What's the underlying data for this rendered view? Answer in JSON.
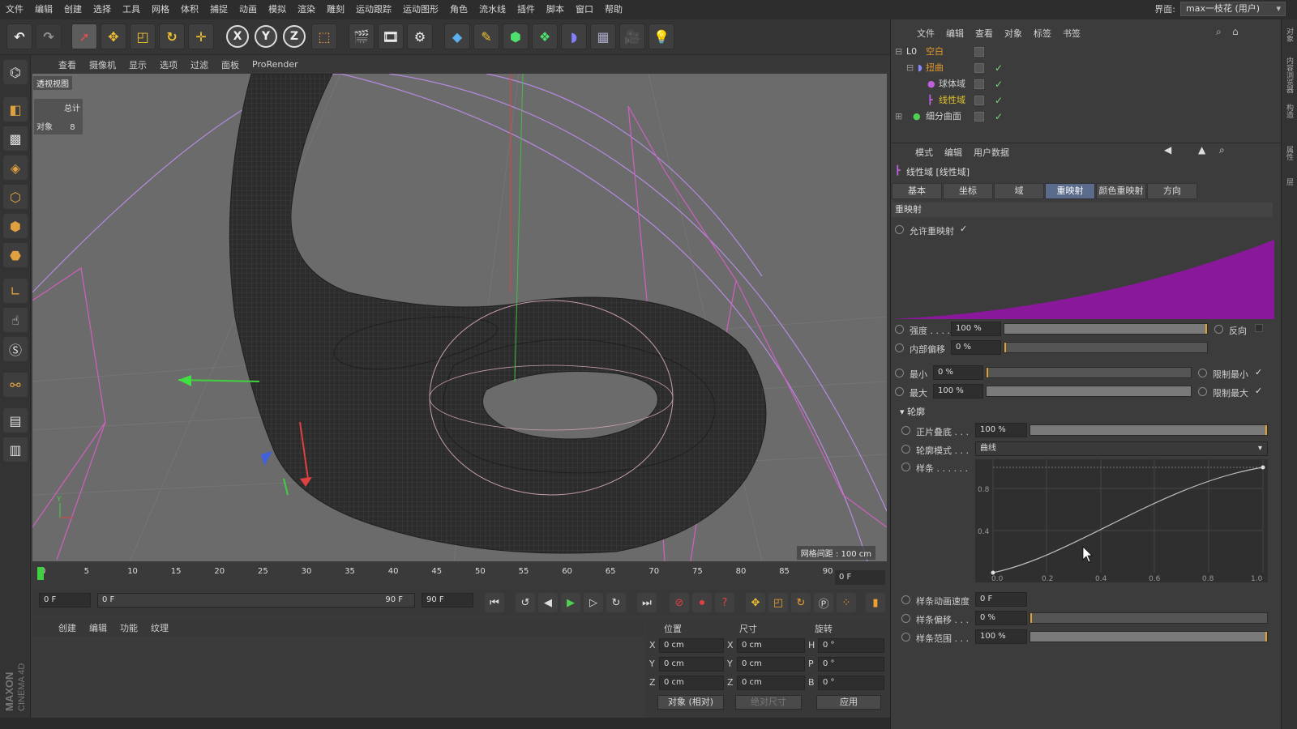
{
  "menubar": {
    "items": [
      "文件",
      "编辑",
      "创建",
      "选择",
      "工具",
      "网格",
      "体积",
      "捕捉",
      "动画",
      "模拟",
      "渲染",
      "雕刻",
      "运动跟踪",
      "运动图形",
      "角色",
      "流水线",
      "插件",
      "脚本",
      "窗口",
      "帮助"
    ],
    "layout_label": "界面:",
    "layout_value": "max一枝花 (用户)"
  },
  "toolbar": {
    "icons": [
      "undo-icon",
      "redo-icon",
      "select-icon",
      "move-icon",
      "scale-icon",
      "rotate-icon",
      "move-all-icon",
      "x-axis-icon",
      "y-axis-icon",
      "z-axis-icon",
      "coord-icon",
      "render-view-icon",
      "render-picture-icon",
      "render-settings-icon",
      "cube-icon",
      "pen-icon",
      "nurbs-icon",
      "array-icon",
      "deformer-icon",
      "floor-icon",
      "camera-icon",
      "light-icon"
    ],
    "x": "X",
    "y": "Y",
    "z": "Z"
  },
  "viewport": {
    "menu": [
      "查看",
      "摄像机",
      "显示",
      "选项",
      "过滤",
      "面板",
      "ProRender"
    ],
    "label": "透视视图",
    "stats_total": "总计",
    "stats_objects_label": "对象",
    "stats_objects_value": "8",
    "grid_text": "网格间距 : 100 cm",
    "axis_y": "Y"
  },
  "timeline": {
    "ticks": [
      "0",
      "5",
      "10",
      "15",
      "20",
      "25",
      "30",
      "35",
      "40",
      "45",
      "50",
      "55",
      "60",
      "65",
      "70",
      "75",
      "80",
      "85",
      "90"
    ],
    "frame_right": "0 F",
    "current_frame": "0 F",
    "range_start": "0 F",
    "range_end": "90 F",
    "max_frame": "90 F"
  },
  "material_menu": [
    "创建",
    "编辑",
    "功能",
    "纹理"
  ],
  "coordinates": {
    "headers": [
      "位置",
      "尺寸",
      "旋转"
    ],
    "rows": [
      {
        "axis": "X",
        "pos": "0 cm",
        "size_axis": "X",
        "size": "0 cm",
        "rot_axis": "H",
        "rot": "0 °"
      },
      {
        "axis": "Y",
        "pos": "0 cm",
        "size_axis": "Y",
        "size": "0 cm",
        "rot_axis": "P",
        "rot": "0 °"
      },
      {
        "axis": "Z",
        "pos": "0 cm",
        "size_axis": "Z",
        "size": "0 cm",
        "rot_axis": "B",
        "rot": "0 °"
      }
    ],
    "mode": "对象 (相对)",
    "size_mode": "绝对尺寸",
    "apply": "应用"
  },
  "object_manager": {
    "menu": [
      "文件",
      "编辑",
      "查看",
      "对象",
      "标签",
      "书签"
    ],
    "objects": [
      {
        "name": "空白",
        "color": "#e39a2c"
      },
      {
        "name": "扭曲",
        "color": "#e39a2c"
      },
      {
        "name": "球体域",
        "color": "#cfcfcf"
      },
      {
        "name": "线性域",
        "color": "#e3c32c"
      },
      {
        "name": "细分曲面",
        "color": "#cfcfcf"
      }
    ]
  },
  "attributes": {
    "menu": [
      "模式",
      "编辑",
      "用户数据"
    ],
    "title": "线性域 [线性域]",
    "tabs": [
      "基本",
      "坐标",
      "域",
      "重映射",
      "颜色重映射",
      "方向"
    ],
    "active_tab": "重映射",
    "section": "重映射",
    "enable_remap": "允许重映射",
    "strength_label": "强度 . . . .",
    "strength_value": "100 %",
    "strength": 1.0,
    "invert_label": "反向",
    "inner_offset_label": "内部偏移",
    "inner_offset_value": "0 %",
    "min_label": "最小",
    "min_value": "0 %",
    "clamp_min_label": "限制最小",
    "max_label": "最大",
    "max_value": "100 %",
    "clamp_max_label": "限制最大",
    "contour_section": "轮廓",
    "steps_label": "正片叠底 . . .",
    "steps_value": "100 %",
    "contour_mode_label": "轮廓模式 . . .",
    "contour_mode_value": "曲线",
    "spline_label": "样条 . . . . . .",
    "spline_anim_label": "样条动画速度",
    "spline_anim_value": "0 F",
    "spline_offset_label": "样条偏移 . . .",
    "spline_offset_value": "0 %",
    "spline_range_label": "样条范围 . . .",
    "spline_range_value": "100 %",
    "graph_y": [
      "0.8",
      "0.4"
    ],
    "graph_x": [
      "0.0",
      "0.2",
      "0.4",
      "0.6",
      "0.8",
      "1.0"
    ],
    "remap_color": "#8a189a"
  },
  "right_strip": [
    "对象",
    "内容浏览器",
    "构造",
    "属性",
    "层"
  ]
}
